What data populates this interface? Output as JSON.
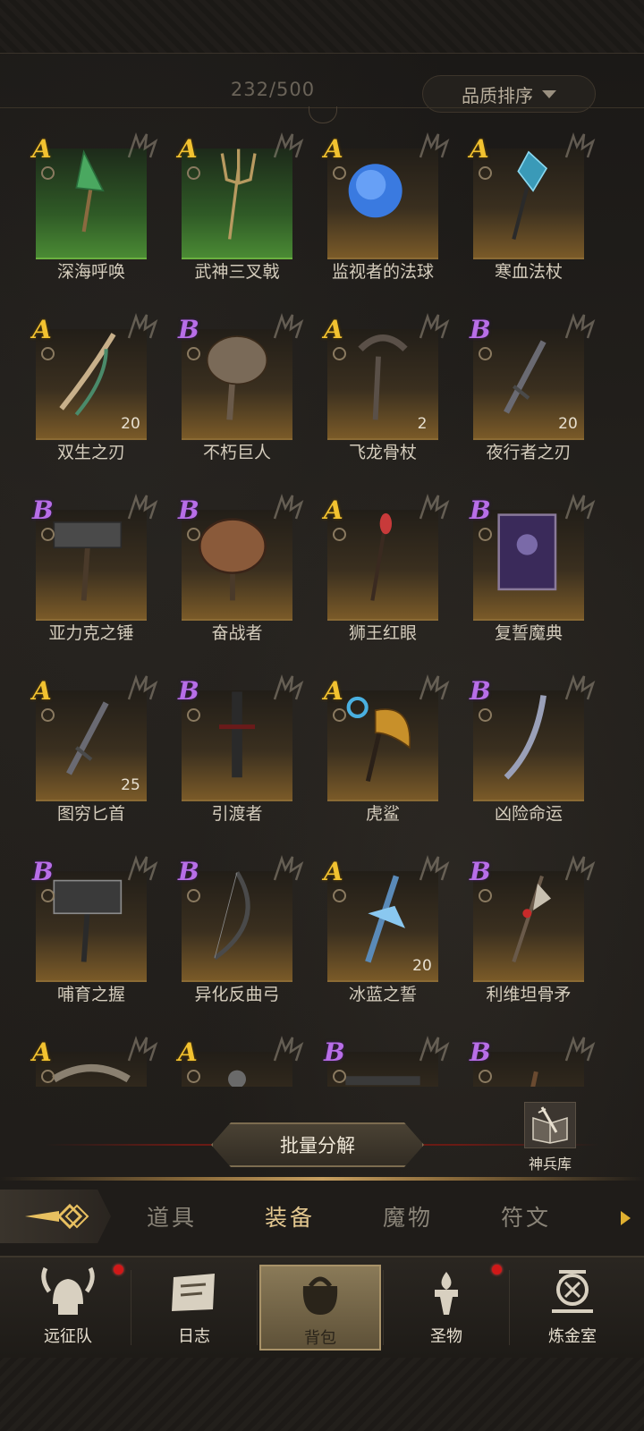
{
  "header": {
    "capacity": "232/500",
    "sort_label": "品质排序"
  },
  "items": [
    {
      "name": "深海呼唤",
      "grade": "A",
      "count": "",
      "icon": "conch-staff-icon",
      "tint": "green"
    },
    {
      "name": "武神三叉戟",
      "grade": "A",
      "count": "",
      "icon": "trident-icon",
      "tint": "green"
    },
    {
      "name": "监视者的法球",
      "grade": "A",
      "count": "",
      "icon": "orb-icon",
      "tint": "gold"
    },
    {
      "name": "寒血法杖",
      "grade": "A",
      "count": "",
      "icon": "ice-staff-icon",
      "tint": "gold"
    },
    {
      "name": "双生之刃",
      "grade": "A",
      "count": "20",
      "icon": "twin-blade-icon",
      "tint": "gold"
    },
    {
      "name": "不朽巨人",
      "grade": "B",
      "count": "",
      "icon": "skull-axe-icon",
      "tint": "gold"
    },
    {
      "name": "飞龙骨杖",
      "grade": "A",
      "count": "2",
      "icon": "bone-staff-icon",
      "tint": "gold"
    },
    {
      "name": "夜行者之刃",
      "grade": "B",
      "count": "20",
      "icon": "dagger-icon",
      "tint": "gold"
    },
    {
      "name": "亚力克之锤",
      "grade": "B",
      "count": "",
      "icon": "hammer-icon",
      "tint": "gold"
    },
    {
      "name": "奋战者",
      "grade": "B",
      "count": "",
      "icon": "battle-axe-icon",
      "tint": "gold"
    },
    {
      "name": "狮王红眼",
      "grade": "A",
      "count": "",
      "icon": "wand-icon",
      "tint": "gold"
    },
    {
      "name": "复誓魔典",
      "grade": "B",
      "count": "",
      "icon": "tome-icon",
      "tint": "gold"
    },
    {
      "name": "图穷匕首",
      "grade": "A",
      "count": "25",
      "icon": "dagger-icon",
      "tint": "gold"
    },
    {
      "name": "引渡者",
      "grade": "B",
      "count": "",
      "icon": "greatsword-icon",
      "tint": "gold"
    },
    {
      "name": "虎鲨",
      "grade": "A",
      "count": "",
      "icon": "axe-icon",
      "tint": "gold"
    },
    {
      "name": "凶险命运",
      "grade": "B",
      "count": "",
      "icon": "knife-icon",
      "tint": "gold"
    },
    {
      "name": "哺育之握",
      "grade": "B",
      "count": "",
      "icon": "web-hammer-icon",
      "tint": "gold"
    },
    {
      "name": "异化反曲弓",
      "grade": "B",
      "count": "",
      "icon": "bow-icon",
      "tint": "gold"
    },
    {
      "name": "冰蓝之誓",
      "grade": "A",
      "count": "20",
      "icon": "ice-sword-icon",
      "tint": "gold"
    },
    {
      "name": "利维坦骨矛",
      "grade": "B",
      "count": "",
      "icon": "spear-icon",
      "tint": "gold"
    },
    {
      "name": "",
      "grade": "A",
      "count": "",
      "icon": "shield-icon",
      "tint": "gold"
    },
    {
      "name": "",
      "grade": "A",
      "count": "",
      "icon": "mace-icon",
      "tint": "gold"
    },
    {
      "name": "",
      "grade": "B",
      "count": "",
      "icon": "gun-icon",
      "tint": "gold"
    },
    {
      "name": "",
      "grade": "B",
      "count": "",
      "icon": "staff-icon",
      "tint": "gold"
    }
  ],
  "actions": {
    "bulk_label": "批量分解",
    "armory_label": "神兵库"
  },
  "tabs": [
    {
      "label": "道具",
      "active": false
    },
    {
      "label": "装备",
      "active": true
    },
    {
      "label": "魔物",
      "active": false
    },
    {
      "label": "符文",
      "active": false
    }
  ],
  "nav": [
    {
      "label": "远征队",
      "badge": true,
      "icon": "viking-helmet-icon",
      "active": false
    },
    {
      "label": "日志",
      "badge": false,
      "icon": "map-scroll-icon",
      "active": false
    },
    {
      "label": "背包",
      "badge": false,
      "icon": "bag-icon",
      "active": true
    },
    {
      "label": "圣物",
      "badge": true,
      "icon": "torch-icon",
      "active": false
    },
    {
      "label": "炼金室",
      "badge": false,
      "icon": "alchemy-icon",
      "active": false
    }
  ],
  "colors": {
    "grade_A": "#f2c230",
    "grade_B": "#b86ee8",
    "badge": "#d01818",
    "active_tab": "#e4c890"
  }
}
